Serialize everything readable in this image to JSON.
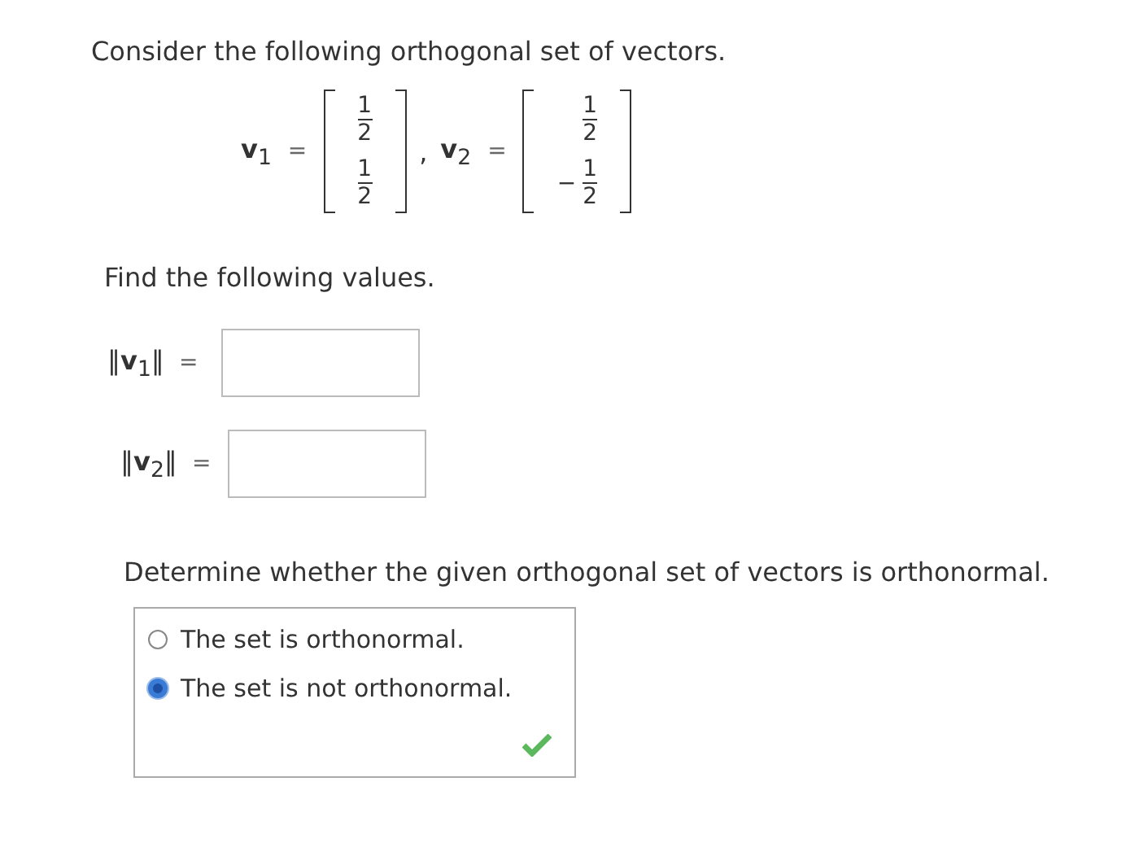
{
  "question": "Consider the following orthogonal set of vectors.",
  "vectors": [
    {
      "label": "**v**$_{1}$",
      "equals": "=",
      "entries": [
        {
          "num": "1",
          "den": "2"
        },
        {
          "num": "1",
          "den": "2"
        }
      ]
    },
    {
      "label": "**v**$_{2}$",
      "equals": "=",
      "entries": [
        {
          "num": "1",
          "den": "2"
        },
        {
          "sign": "−",
          "num": "1",
          "den": "2"
        }
      ]
    }
  ],
  "separator": ",",
  "prompt": "Find the following values.",
  "answers": [
    {
      "label": "‖**v**$_{1}$‖",
      "equals": "="
    },
    {
      "label": "‖**v**$_{2}$‖",
      "equals": "="
    }
  ],
  "question2": "Determine whether the given orthogonal set of vectors is orthonormal.",
  "options": [
    {
      "label": "The set is orthonormal.",
      "selected": false
    },
    {
      "label": "The set is not orthonormal.",
      "selected": true
    }
  ],
  "result": {
    "correct": true
  }
}
